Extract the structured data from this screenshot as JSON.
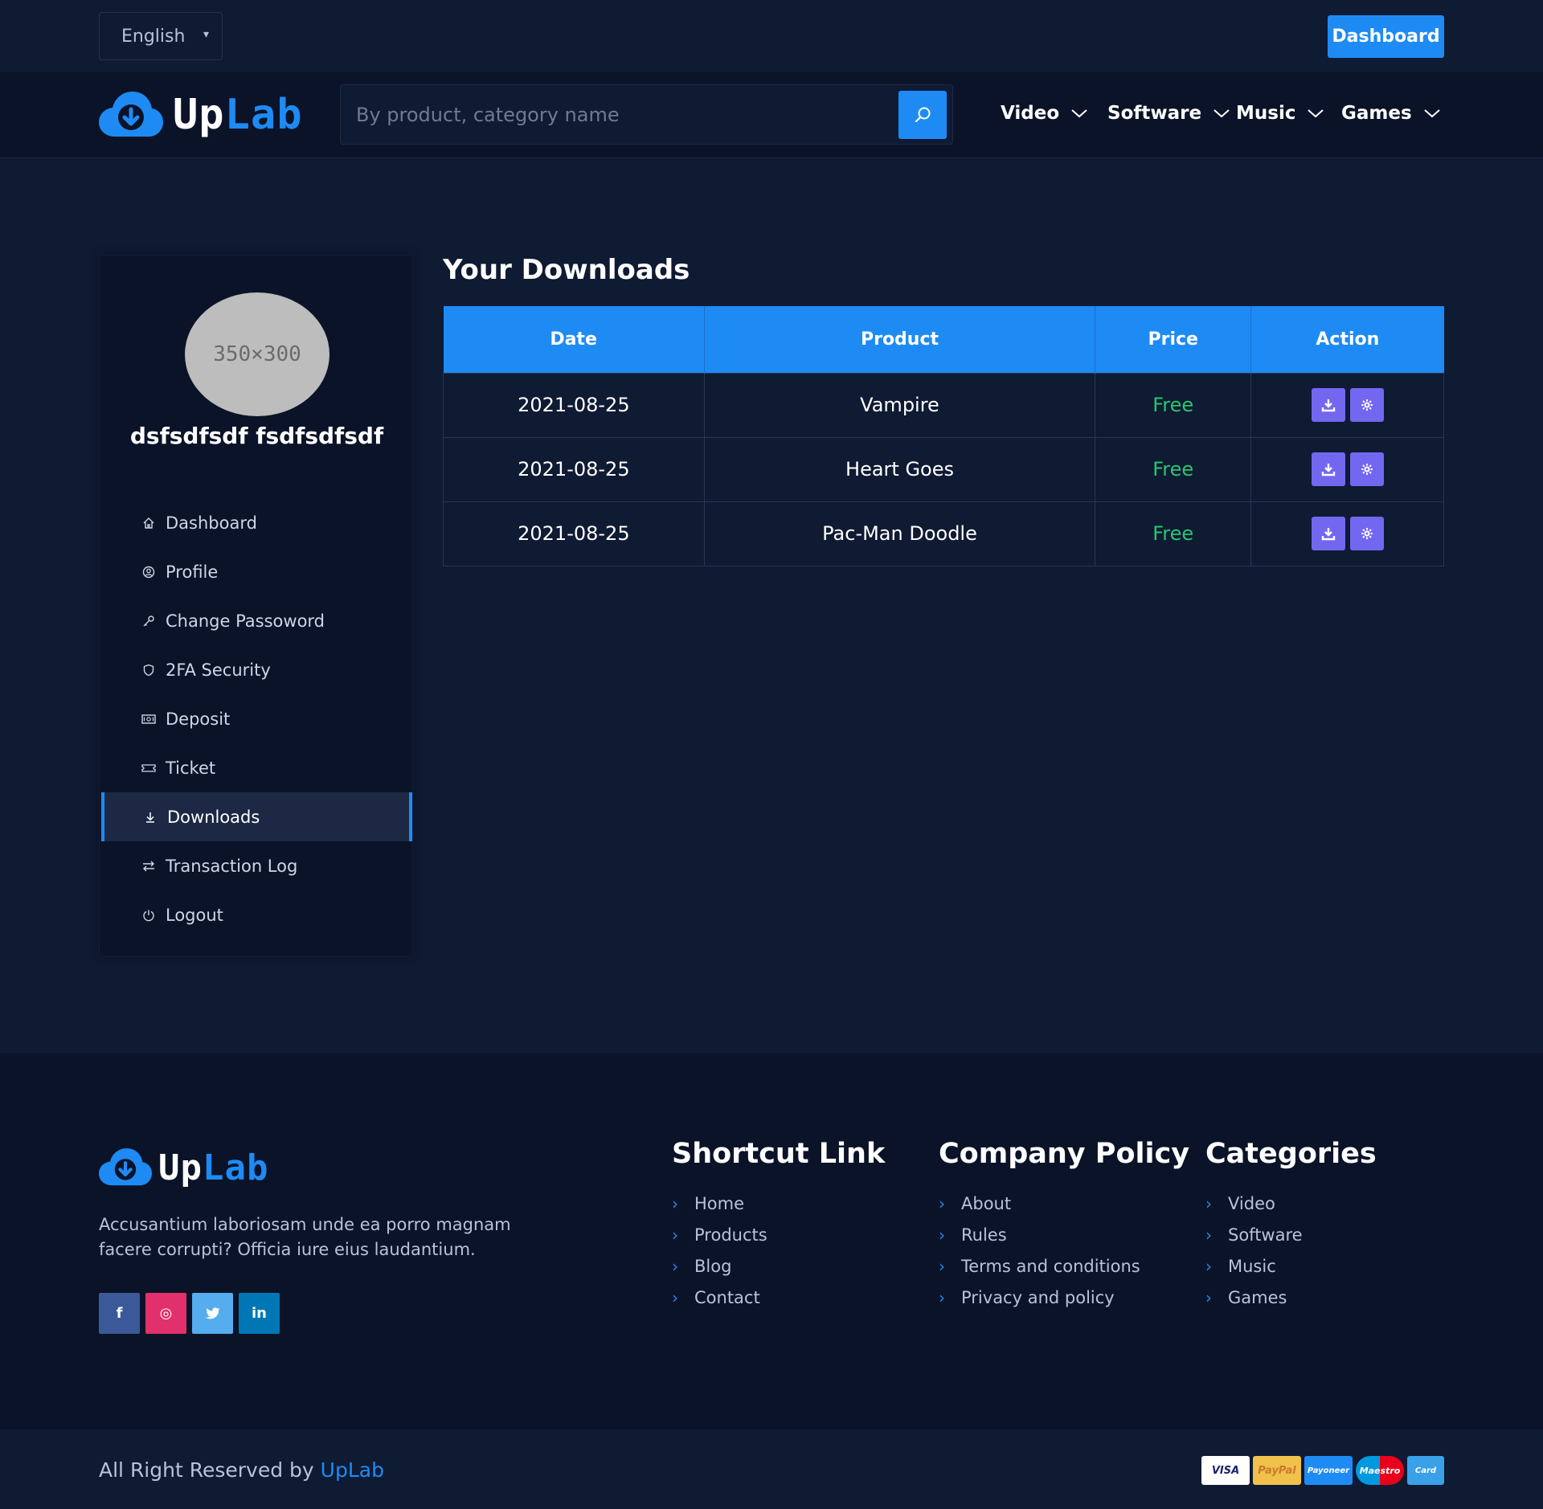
{
  "topbar": {
    "language": "English",
    "dashboard_label": "Dashboard"
  },
  "brand": {
    "name_main": "Up",
    "name_accent": "Lab",
    "accent_color": "#1e8bf5"
  },
  "search": {
    "placeholder": "By product, category name",
    "icon": "search-icon"
  },
  "nav": {
    "items": [
      {
        "label": "Video"
      },
      {
        "label": "Software"
      },
      {
        "label": "Music"
      },
      {
        "label": "Games"
      }
    ]
  },
  "sidebar": {
    "avatar_text": "350×300",
    "user_name": "dsfsdfsdf fsdfsdfsdf",
    "items": [
      {
        "label": "Dashboard",
        "icon": "home-icon"
      },
      {
        "label": "Profile",
        "icon": "user-circle-icon"
      },
      {
        "label": "Change Passoword",
        "icon": "key-icon"
      },
      {
        "label": "2FA Security",
        "icon": "shield-icon"
      },
      {
        "label": "Deposit",
        "icon": "money-icon"
      },
      {
        "label": "Ticket",
        "icon": "ticket-icon"
      },
      {
        "label": "Downloads",
        "icon": "download-icon",
        "active": true
      },
      {
        "label": "Transaction Log",
        "icon": "exchange-icon"
      },
      {
        "label": "Logout",
        "icon": "power-icon"
      }
    ]
  },
  "downloads": {
    "title": "Your Downloads",
    "columns": [
      "Date",
      "Product",
      "Price",
      "Action"
    ],
    "rows": [
      {
        "date": "2021-08-25",
        "product": "Vampire",
        "price": "Free"
      },
      {
        "date": "2021-08-25",
        "product": "Heart Goes",
        "price": "Free"
      },
      {
        "date": "2021-08-25",
        "product": "Pac-Man Doodle",
        "price": "Free"
      }
    ]
  },
  "footer": {
    "about": "Accusantium laboriosam unde ea porro magnam facere corrupti? Officia iure eius laudantium.",
    "socials": [
      {
        "icon": "facebook-icon",
        "glyph": "f",
        "color": "#3b5998"
      },
      {
        "icon": "instagram-icon",
        "glyph": "◎",
        "color": "#e1306c"
      },
      {
        "icon": "twitter-icon",
        "glyph": "🐦",
        "color": "#55acee"
      },
      {
        "icon": "linkedin-icon",
        "glyph": "in",
        "color": "#0077b5"
      }
    ],
    "columns": [
      {
        "title": "Shortcut Link",
        "links": [
          "Home",
          "Products",
          "Blog",
          "Contact"
        ]
      },
      {
        "title": "Company Policy",
        "links": [
          "About",
          "Rules",
          "Terms and conditions",
          "Privacy and policy"
        ]
      },
      {
        "title": "Categories",
        "links": [
          "Video",
          "Software",
          "Music",
          "Games"
        ]
      }
    ],
    "copyright_prefix": "All Right Reserved by",
    "copyright_brand": "UpLab",
    "payments": [
      {
        "name": "VISA",
        "color": "#1a1f71"
      },
      {
        "name": "PayPal",
        "color": "#f0c14b"
      },
      {
        "name": "Payoneer",
        "color": "#1e8bf5"
      },
      {
        "name": "Maestro",
        "color": "#0099df"
      },
      {
        "name": "Card",
        "color": "#3aa0e8"
      }
    ]
  }
}
